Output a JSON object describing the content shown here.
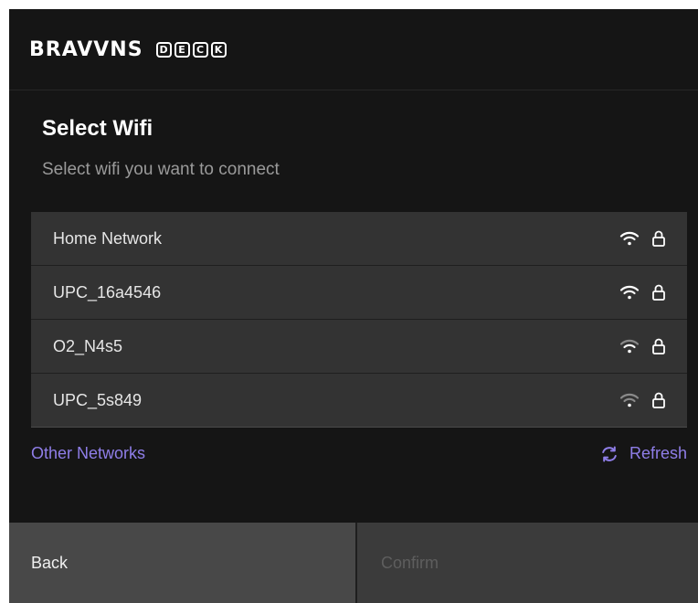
{
  "brand": {
    "word": "BRAVVNS",
    "deck_letters": [
      "D",
      "E",
      "C",
      "K"
    ]
  },
  "page": {
    "title": "Select Wifi",
    "subtitle": "Select wifi you want to connect"
  },
  "networks": [
    {
      "name": "Home Network",
      "signal": "strong",
      "signal_icon": "wifi-icon",
      "secured_icon": "lock-icon"
    },
    {
      "name": "UPC_16a4546",
      "signal": "strong",
      "signal_icon": "wifi-icon",
      "secured_icon": "lock-icon"
    },
    {
      "name": "O2_N4s5",
      "signal": "medium",
      "signal_icon": "wifi-icon",
      "secured_icon": "lock-icon"
    },
    {
      "name": "UPC_5s849",
      "signal": "weak",
      "signal_icon": "wifi-icon",
      "secured_icon": "lock-icon"
    }
  ],
  "links": {
    "other_networks": "Other Networks",
    "refresh": "Refresh",
    "refresh_icon": "refresh-icon"
  },
  "footer": {
    "back_label": "Back",
    "confirm_label": "Confirm"
  },
  "colors": {
    "background": "#151515",
    "row": "#333333",
    "accent": "#8f7ee8",
    "back_button": "#484848",
    "confirm_button": "#3b3b3b"
  }
}
